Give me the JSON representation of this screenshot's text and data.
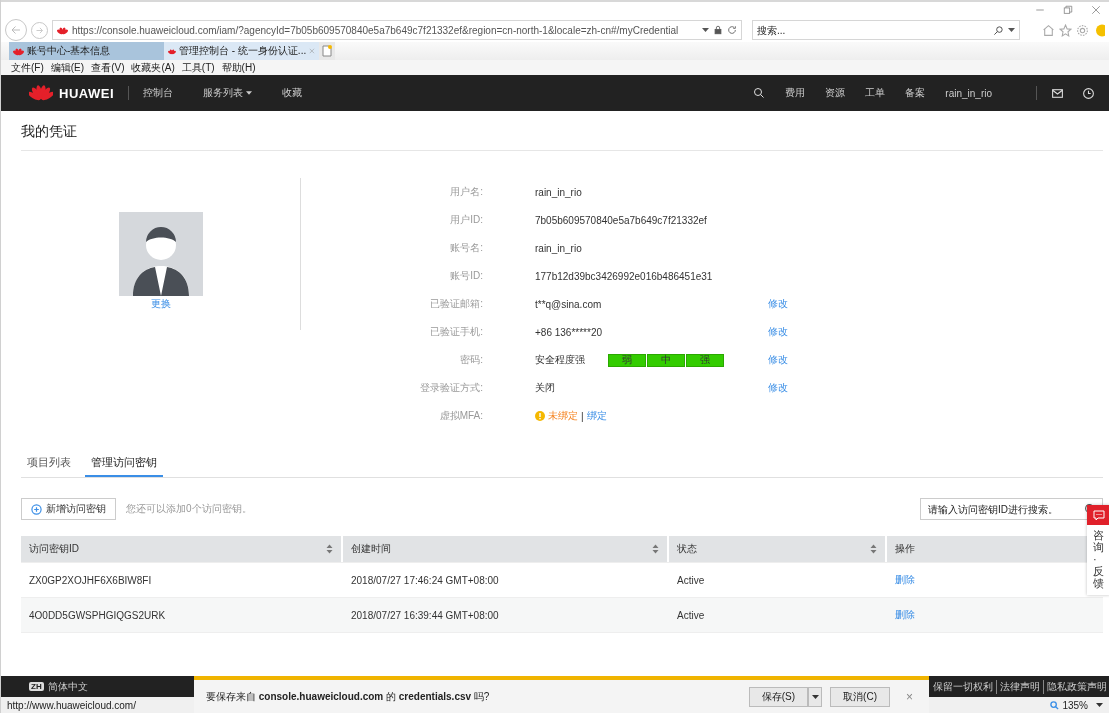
{
  "browser": {
    "url": "https://console.huaweicloud.com/iam/?agencyId=7b05b609570840e5a7b649c7f21332ef&region=cn-north-1&locale=zh-cn#/myCredential",
    "search_placeholder": "搜索...",
    "tabs": [
      {
        "title": "账号中心-基本信息",
        "selected": false
      },
      {
        "title": "管理控制台 - 统一身份认证...",
        "selected": true
      }
    ],
    "menu": [
      "文件(F)",
      "编辑(E)",
      "查看(V)",
      "收藏夹(A)",
      "工具(T)",
      "帮助(H)"
    ]
  },
  "topnav": {
    "brand": "HUAWEI",
    "left_links": [
      {
        "label": "控制台",
        "dropdown": false
      },
      {
        "label": "服务列表",
        "dropdown": true
      },
      {
        "label": "收藏",
        "dropdown": false
      }
    ],
    "right_links": [
      "费用",
      "资源",
      "工单",
      "备案"
    ],
    "user": "rain_in_rio"
  },
  "page": {
    "title": "我的凭证",
    "avatar_link": "更换",
    "fields": [
      {
        "kind": "text",
        "label": "用户名:",
        "value": "rain_in_rio"
      },
      {
        "kind": "text",
        "label": "用户ID:",
        "value": "7b05b609570840e5a7b649c7f21332ef"
      },
      {
        "kind": "text",
        "label": "账号名:",
        "value": "rain_in_rio"
      },
      {
        "kind": "text",
        "label": "账号ID:",
        "value": "177b12d39bc3426992e016b486451e31"
      },
      {
        "kind": "text",
        "label": "已验证邮箱:",
        "value": "t**q@sina.com",
        "action": "修改"
      },
      {
        "kind": "text",
        "label": "已验证手机:",
        "value": "+86 136*****20",
        "action": "修改"
      },
      {
        "kind": "strength",
        "label": "密码:",
        "value": "安全程度强",
        "segments": [
          {
            "label": "弱",
            "filled": true
          },
          {
            "label": "中",
            "filled": true
          },
          {
            "label": "强",
            "filled": true
          }
        ],
        "action": "修改"
      },
      {
        "kind": "text",
        "label": "登录验证方式:",
        "value": "关闭",
        "action": "修改"
      },
      {
        "kind": "mfa",
        "label": "虚拟MFA:",
        "status": "未绑定",
        "separator": "|",
        "link": "绑定"
      }
    ]
  },
  "tabs": [
    {
      "label": "项目列表",
      "selected": false
    },
    {
      "label": "管理访问密钥",
      "selected": true
    }
  ],
  "toolbar": {
    "add_button": "新增访问密钥",
    "hint": "您还可以添加0个访问密钥。",
    "search_placeholder": "请输入访问密钥ID进行搜索。"
  },
  "table": {
    "columns": [
      {
        "label": "访问密钥ID",
        "sortable": true
      },
      {
        "label": "创建时间",
        "sortable": true
      },
      {
        "label": "状态",
        "sortable": true
      },
      {
        "label": "操作",
        "sortable": false
      }
    ],
    "rows": [
      {
        "id": "ZX0GP2XOJHF6X6BIW8FI",
        "created": "2018/07/27 17:46:24 GMT+08:00",
        "status": "Active",
        "action": "删除"
      },
      {
        "id": "4O0DD5GWSPHGIQGS2URK",
        "created": "2018/07/27 16:39:44 GMT+08:00",
        "status": "Active",
        "action": "删除"
      }
    ]
  },
  "feedback": {
    "label": "咨询·反馈"
  },
  "footer": {
    "language_badge": "ZH",
    "language": "简体中文",
    "links": [
      "保留一切权利",
      "法律声明",
      "隐私政策声明"
    ]
  },
  "download_bar": {
    "message": "要保存来自 **console.huaweicloud.com** 的 **credentials.csv** 吗?",
    "save": "保存(S)",
    "cancel": "取消(C)",
    "close": "×"
  },
  "status_bar": {
    "url": "http://www.huaweicloud.com/",
    "zoom": "135%"
  }
}
